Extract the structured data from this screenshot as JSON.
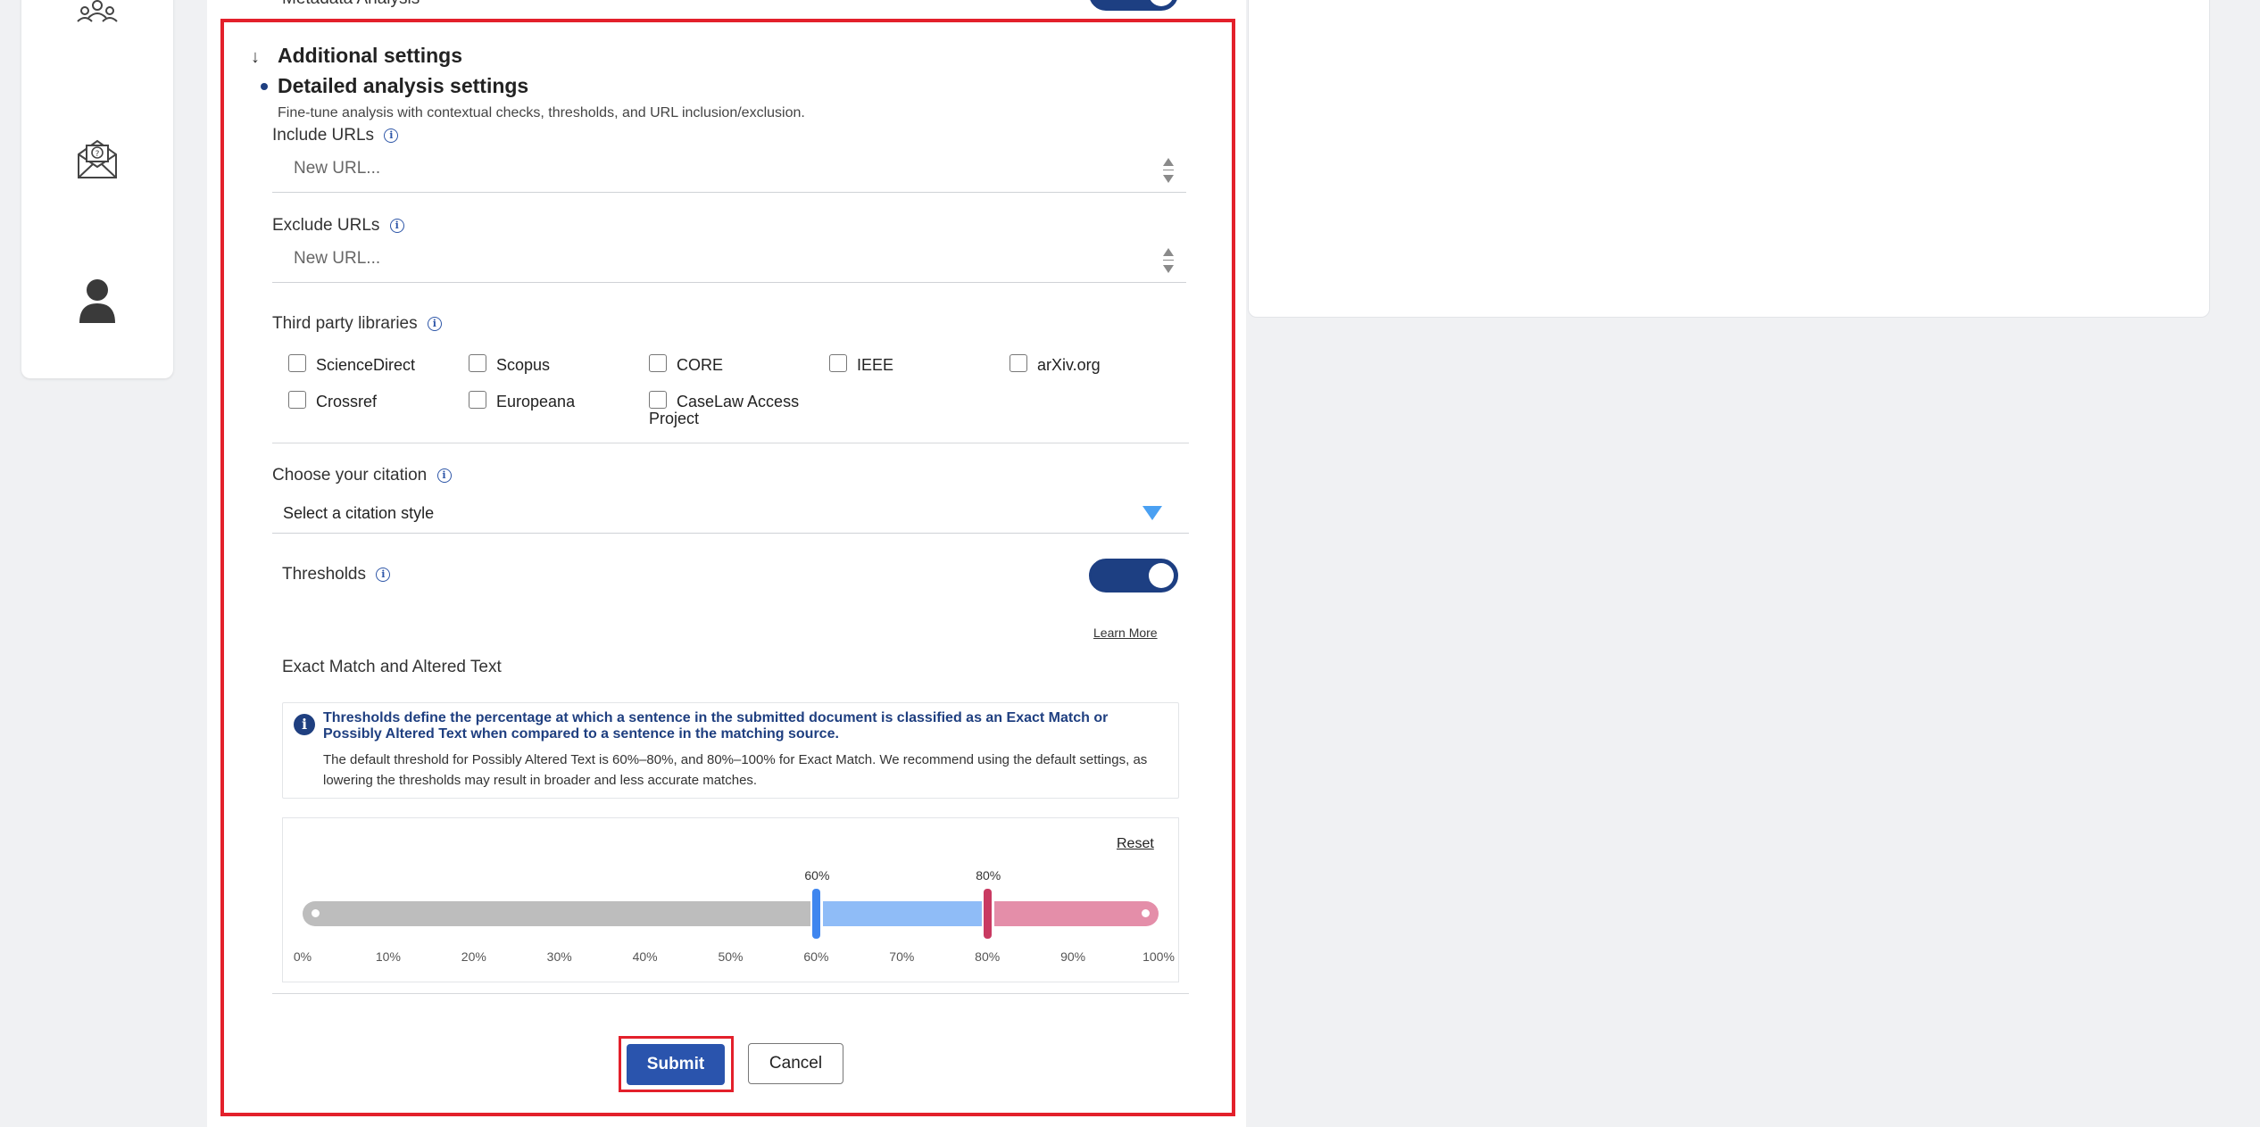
{
  "top": {
    "metadata_label": "Metadata Analysis"
  },
  "section": {
    "title": "Additional settings",
    "subtitle": "Detailed analysis settings",
    "description": "Fine-tune analysis with contextual checks, thresholds, and URL inclusion/exclusion."
  },
  "include_urls": {
    "label": "Include URLs",
    "placeholder": "New URL..."
  },
  "exclude_urls": {
    "label": "Exclude URLs",
    "placeholder": "New URL..."
  },
  "libraries": {
    "label": "Third party libraries",
    "items": [
      {
        "label": "ScienceDirect",
        "checked": false
      },
      {
        "label": "Scopus",
        "checked": false
      },
      {
        "label": "CORE",
        "checked": false
      },
      {
        "label": "IEEE",
        "checked": false
      },
      {
        "label": "arXiv.org",
        "checked": false
      },
      {
        "label": "Crossref",
        "checked": false
      },
      {
        "label": "Europeana",
        "checked": false
      },
      {
        "label": "CaseLaw Access Project",
        "checked": false
      }
    ]
  },
  "citation": {
    "label": "Choose your citation",
    "selected": "Select a citation style"
  },
  "thresholds": {
    "label": "Thresholds",
    "enabled": true,
    "learn_more": "Learn More",
    "subheading": "Exact Match and Altered Text",
    "info_title": "Thresholds define the percentage at which a sentence in the submitted document is classified as an Exact Match or Possibly Altered Text when compared to a sentence in the matching source.",
    "info_body": "The default threshold for Possibly Altered Text is 60%–80%, and 80%–100% for Exact Match. We recommend using the default settings, as lowering the thresholds may result in broader and less accurate matches.",
    "reset": "Reset",
    "lower_value": 60,
    "upper_value": 80,
    "lower_label": "60%",
    "upper_label": "80%",
    "ticks": [
      "0%",
      "10%",
      "20%",
      "30%",
      "40%",
      "50%",
      "60%",
      "70%",
      "80%",
      "90%",
      "100%"
    ],
    "colors": {
      "low": "#bdbdbd",
      "mid": "#8fbcf7",
      "high": "#e48ea9",
      "lower_handle": "#3f86ef",
      "upper_handle": "#c93a62"
    }
  },
  "actions": {
    "submit": "Submit",
    "cancel": "Cancel"
  },
  "sidebar": {
    "icons": [
      "team-icon",
      "help-mail-icon",
      "user-icon"
    ]
  }
}
